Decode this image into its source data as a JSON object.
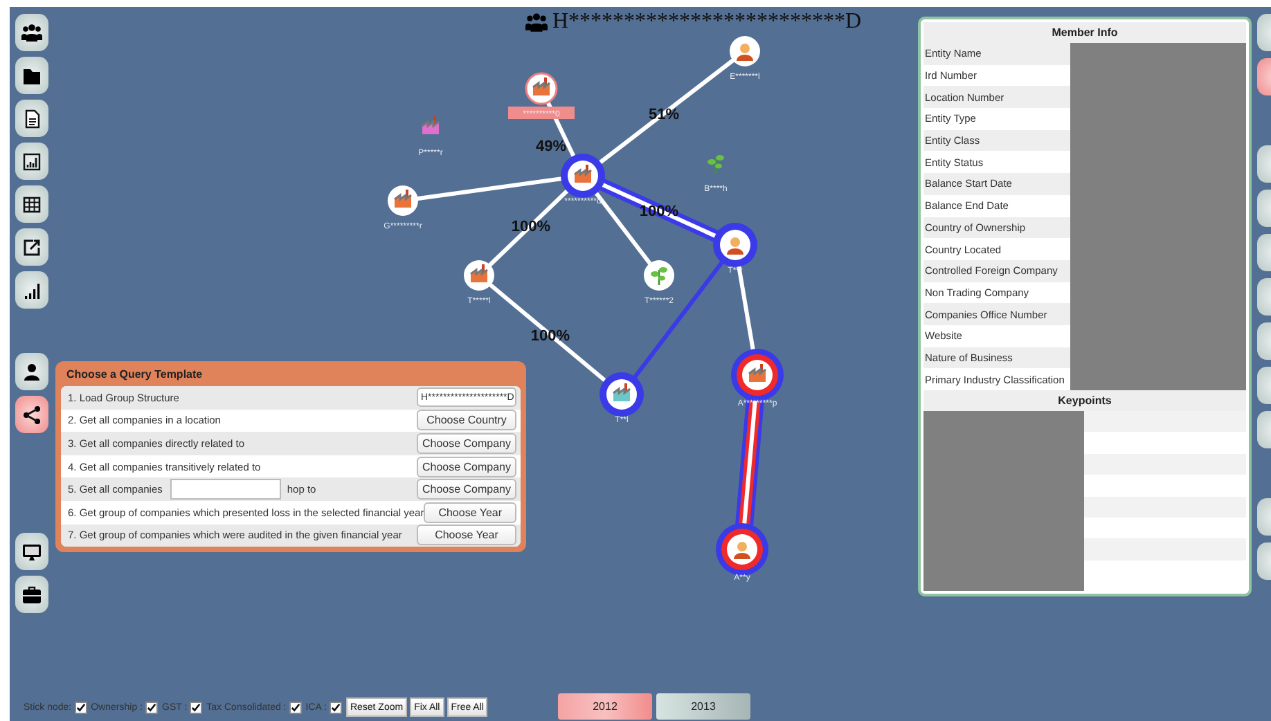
{
  "graph": {
    "title": "H*************************D",
    "nodes": [
      {
        "label": "**********d",
        "kind": "company"
      },
      {
        "label": "E*******l",
        "kind": "person"
      },
      {
        "label": "**********0",
        "kind": "company"
      },
      {
        "label": "P*****r",
        "kind": "pink-company"
      },
      {
        "label": "G*********r",
        "kind": "company"
      },
      {
        "label": "B****h",
        "kind": "plant"
      },
      {
        "label": "T***",
        "kind": "person"
      },
      {
        "label": "T*****l",
        "kind": "company"
      },
      {
        "label": "T******2",
        "kind": "plant"
      },
      {
        "label": "T**l",
        "kind": "teal-company"
      },
      {
        "label": "A*********p",
        "kind": "company"
      },
      {
        "label": "A**y",
        "kind": "person"
      }
    ],
    "edge_labels": [
      "51%",
      "49%",
      "100%",
      "100%",
      "100%"
    ]
  },
  "left_toolbar": [
    {
      "kind": "group",
      "selected": false
    },
    {
      "kind": "folder",
      "selected": false
    },
    {
      "kind": "document",
      "selected": false
    },
    {
      "kind": "chart",
      "selected": false
    },
    {
      "kind": "table",
      "selected": false
    },
    {
      "kind": "export",
      "selected": false
    },
    {
      "kind": "signal",
      "selected": false
    },
    {
      "kind": "user",
      "selected": false
    },
    {
      "kind": "share",
      "selected": true
    },
    {
      "kind": "monitor",
      "selected": false
    },
    {
      "kind": "briefcase",
      "selected": false
    }
  ],
  "right_toolbar": [
    {
      "selected": false
    },
    {
      "selected": true
    },
    {
      "selected": false
    },
    {
      "selected": false
    },
    {
      "selected": false
    },
    {
      "selected": false
    },
    {
      "selected": false
    },
    {
      "selected": false
    },
    {
      "selected": false
    },
    {
      "selected": false
    },
    {
      "selected": false
    }
  ],
  "query_panel": {
    "title": "Choose a Query Template",
    "rows": [
      {
        "kind": "value",
        "text": "1. Load Group Structure",
        "value": "H*********************D"
      },
      {
        "kind": "button",
        "text": "2. Get all companies in a location",
        "button": "Choose Country"
      },
      {
        "kind": "button",
        "text": "3. Get all companies directly related to",
        "button": "Choose Company"
      },
      {
        "kind": "button",
        "text": "4. Get all companies transitively related to",
        "button": "Choose Company"
      },
      {
        "kind": "hop",
        "text": "5. Get all companies",
        "suffix": "hop to",
        "button": "Choose Company"
      },
      {
        "kind": "button",
        "text": "6. Get group of companies which presented loss in the selected financial year",
        "button": "Choose Year"
      },
      {
        "kind": "button",
        "text": "7. Get group of companies which were audited in the given financial year",
        "button": "Choose Year"
      }
    ]
  },
  "member_info": {
    "title": "Member Info",
    "fields": [
      "Entity Name",
      "Ird Number",
      "Location Number",
      "Entity Type",
      "Entity Class",
      "Entity Status",
      "Balance Start Date",
      "Balance End Date",
      "Country of Ownership",
      "Country Located",
      "Controlled Foreign Company",
      "Non Trading Company",
      "Companies Office Number",
      "Website",
      "Nature of Business",
      "Primary Industry Classification"
    ],
    "keypoints_title": "Keypoints"
  },
  "options": [
    {
      "label": "Stick node:",
      "checked": true
    },
    {
      "label": "Ownership :",
      "checked": true
    },
    {
      "label": "GST :",
      "checked": true
    },
    {
      "label": "Tax Consolidated :",
      "checked": true
    },
    {
      "label": "ICA :",
      "checked": true
    }
  ],
  "actions": [
    "Reset Zoom",
    "Fix All",
    "Free All"
  ],
  "years": [
    {
      "label": "2012",
      "selected": true
    },
    {
      "label": "2013",
      "selected": false
    }
  ]
}
